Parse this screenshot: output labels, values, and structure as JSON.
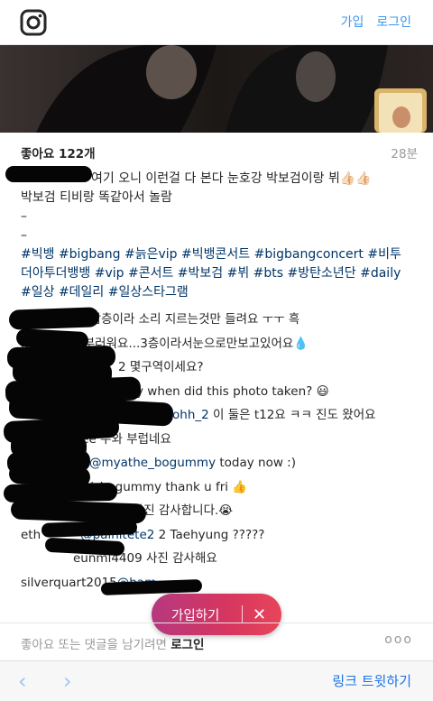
{
  "header": {
    "signup": "가입",
    "login": "로그인"
  },
  "post": {
    "likes": "좋아요 122개",
    "time": "28분",
    "caption": [
      "여기 오니 이런걸 다 본다 눈호강 박보검이랑 뷔👍🏻👍🏻",
      "박보검 티비랑 똑같아서 놀람",
      "–",
      "–"
    ],
    "tags": [
      "#빅뱅 #bigbang #늙은vip #빅뱅콘서트 #bigbangconcert #비투",
      "더아투더뱅뱅 #vip #콘서트 #박보검 #뷔 #bts #방탄소년단 #daily",
      "#일상 #데일리 #일상스타그램"
    ],
    "comments": [
      {
        "pre": "",
        "user": "",
        "text": "전 삼층이라 소리 지르는것만 들려요 ㅜㅜ 흑"
      },
      {
        "pre": "mu",
        "user": "",
        "text": "부러워요...3층이라서눈으로만보고있어요💧"
      },
      {
        "pre": "",
        "user": "",
        "text": "2 몇구역이세요?"
      },
      {
        "pre": "",
        "user": "",
        "text": "y when did this photo taken? 😃"
      },
      {
        "pre": "",
        "user": "ohh_2",
        "text": " 이 둘은 t12요 ㅋㅋ 진도 왔어요"
      },
      {
        "pre": "",
        "user": "",
        "text": "vicee 우와 부럽네요"
      },
      {
        "pre": "",
        "user": "@myathe_bogummy",
        "text": " today now :)"
      },
      {
        "pre": "my",
        "user": "",
        "text": "thel_bogummy thank u fri 👍"
      },
      {
        "pre": "016",
        "user": "",
        "text": "사진 감사합니다.😭"
      },
      {
        "pre": "eth",
        "user": "@palnitete2",
        "text": " 2 Taehyung ?????"
      },
      {
        "pre": "",
        "user": "",
        "text": "eunmi4409 사진 감사해요"
      },
      {
        "pre": "silverquart2015",
        "user": "@ham",
        "text": ""
      }
    ]
  },
  "floating": {
    "signup": "가입하기",
    "close": "✕"
  },
  "prompt": {
    "text": "좋아요 또는 댓글을 남기려면 ",
    "login": "로그인",
    "dots": "ooo"
  },
  "browser": {
    "back": "‹",
    "forward": "›",
    "share": "링크 트윗하기"
  }
}
